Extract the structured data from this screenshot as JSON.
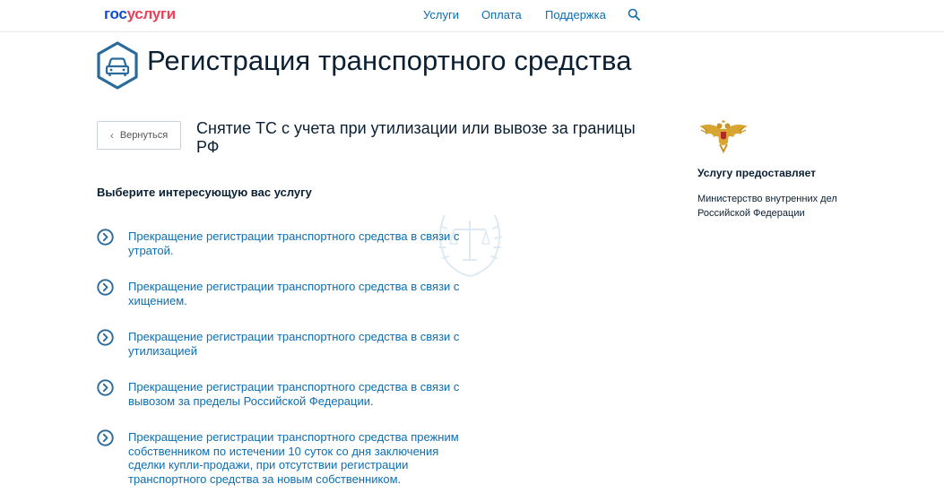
{
  "header": {
    "logo_part1": "гос",
    "logo_part2": "услуги",
    "nav": [
      "Услуги",
      "Оплата",
      "Поддержка"
    ],
    "search_icon": "search-icon"
  },
  "page": {
    "title": "Регистрация транспортного средства",
    "title_icon": "car-hexagon-icon",
    "back_label": "Вернуться",
    "subtitle": "Снятие ТС с учета при утилизации или вывозе за границы РФ"
  },
  "services": {
    "heading": "Выберите интересующую вас услугу",
    "item_icon": "chevron-circle-right-icon",
    "items": [
      "Прекращение регистрации транспортного средства в связи с утратой.",
      "Прекращение регистрации транспортного средства в связи с хищением.",
      "Прекращение регистрации транспортного средства в связи с утилизацией",
      "Прекращение регистрации транспортного средства в связи с вывозом за пределы Российской Федерации.",
      "Прекращение регистрации транспортного средства прежним собственником по истечении 10 суток со дня заключения сделки купли-продажи, при отсутствии регистрации транспортного средства за новым собственником."
    ]
  },
  "provider": {
    "emblem": "double-headed-eagle-emblem",
    "heading": "Услугу предоставляет",
    "name": "Министерство внутренних дел Российской Федерации"
  },
  "colors": {
    "brand_blue": "#0d4cd3",
    "brand_red": "#ee3f58",
    "link": "#0d6eb2",
    "icon_blue": "#2b6b9c",
    "text": "#0b1f33"
  }
}
